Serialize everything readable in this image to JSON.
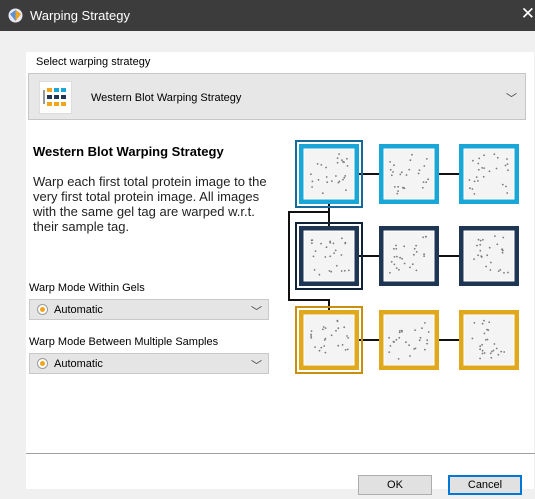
{
  "window": {
    "title": "Warping Strategy",
    "icon": "gem-icon",
    "close_icon": "close-icon"
  },
  "strategy": {
    "label": "Select warping strategy",
    "selected": "Western Blot Warping Strategy",
    "icon": "grid-strategy-icon"
  },
  "info": {
    "heading": "Western Blot Warping Strategy",
    "description": "Warp each first total protein image to the very first total protein image. All images with the same gel tag are warped w.r.t. their sample tag."
  },
  "within_gels": {
    "label": "Warp Mode Within Gels",
    "value": "Automatic"
  },
  "between_samples": {
    "label": "Warp Mode Between Multiple Samples",
    "value": "Automatic"
  },
  "diagram": {
    "rows": [
      {
        "color": "#19a7d8",
        "first_outer": "#146a9a"
      },
      {
        "color": "#1e3654",
        "first_outer": "#0f2238"
      },
      {
        "color": "#e0a81c",
        "first_outer": "#c98f0c"
      }
    ]
  },
  "buttons": {
    "ok": "OK",
    "cancel": "Cancel"
  },
  "colors": {
    "accent": "#0078d7",
    "radio": "#f2a51a",
    "titlebar": "#3c3c3c"
  }
}
